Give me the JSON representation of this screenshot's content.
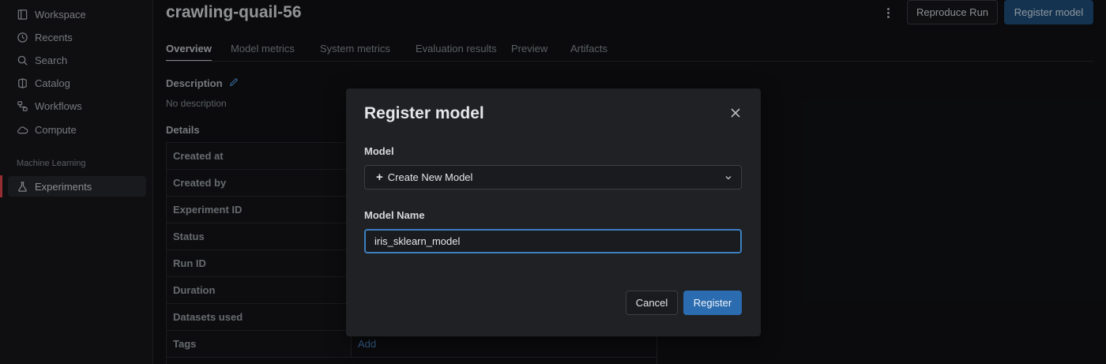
{
  "sidebar": {
    "items": [
      {
        "label": "Workspace",
        "icon": "workspace-icon"
      },
      {
        "label": "Recents",
        "icon": "clock-icon"
      },
      {
        "label": "Search",
        "icon": "search-icon"
      },
      {
        "label": "Catalog",
        "icon": "catalog-icon"
      },
      {
        "label": "Workflows",
        "icon": "workflows-icon"
      },
      {
        "label": "Compute",
        "icon": "cloud-icon"
      }
    ],
    "section_label": "Machine Learning",
    "ml_items": [
      {
        "label": "Experiments",
        "icon": "flask-icon",
        "active": true
      }
    ],
    "active_accent": "#e5484d"
  },
  "header": {
    "run_name": "crawling-quail-56",
    "reproduce_label": "Reproduce Run",
    "register_label": "Register model"
  },
  "tabs": [
    {
      "label": "Overview",
      "active": true
    },
    {
      "label": "Model metrics"
    },
    {
      "label": "System metrics"
    },
    {
      "label": "Evaluation results"
    },
    {
      "label": "Preview"
    },
    {
      "label": "Artifacts"
    }
  ],
  "overview": {
    "description_label": "Description",
    "description_value": "No description",
    "details_label": "Details",
    "details_rows": [
      {
        "key": "Created at",
        "value": ""
      },
      {
        "key": "Created by",
        "value": ""
      },
      {
        "key": "Experiment ID",
        "value": ""
      },
      {
        "key": "Status",
        "value": ""
      },
      {
        "key": "Run ID",
        "value": ""
      },
      {
        "key": "Duration",
        "value": ""
      },
      {
        "key": "Datasets used",
        "value": ""
      },
      {
        "key": "Tags",
        "value": "Add"
      }
    ]
  },
  "modal": {
    "title": "Register model",
    "model_label": "Model",
    "model_selected": "Create New Model",
    "model_name_label": "Model Name",
    "model_name_value": "iris_sklearn_model",
    "cancel_label": "Cancel",
    "register_label": "Register"
  },
  "colors": {
    "primary": "#2b6cb0",
    "focus_border": "#3d7fc0",
    "link": "#4f8fcf"
  }
}
